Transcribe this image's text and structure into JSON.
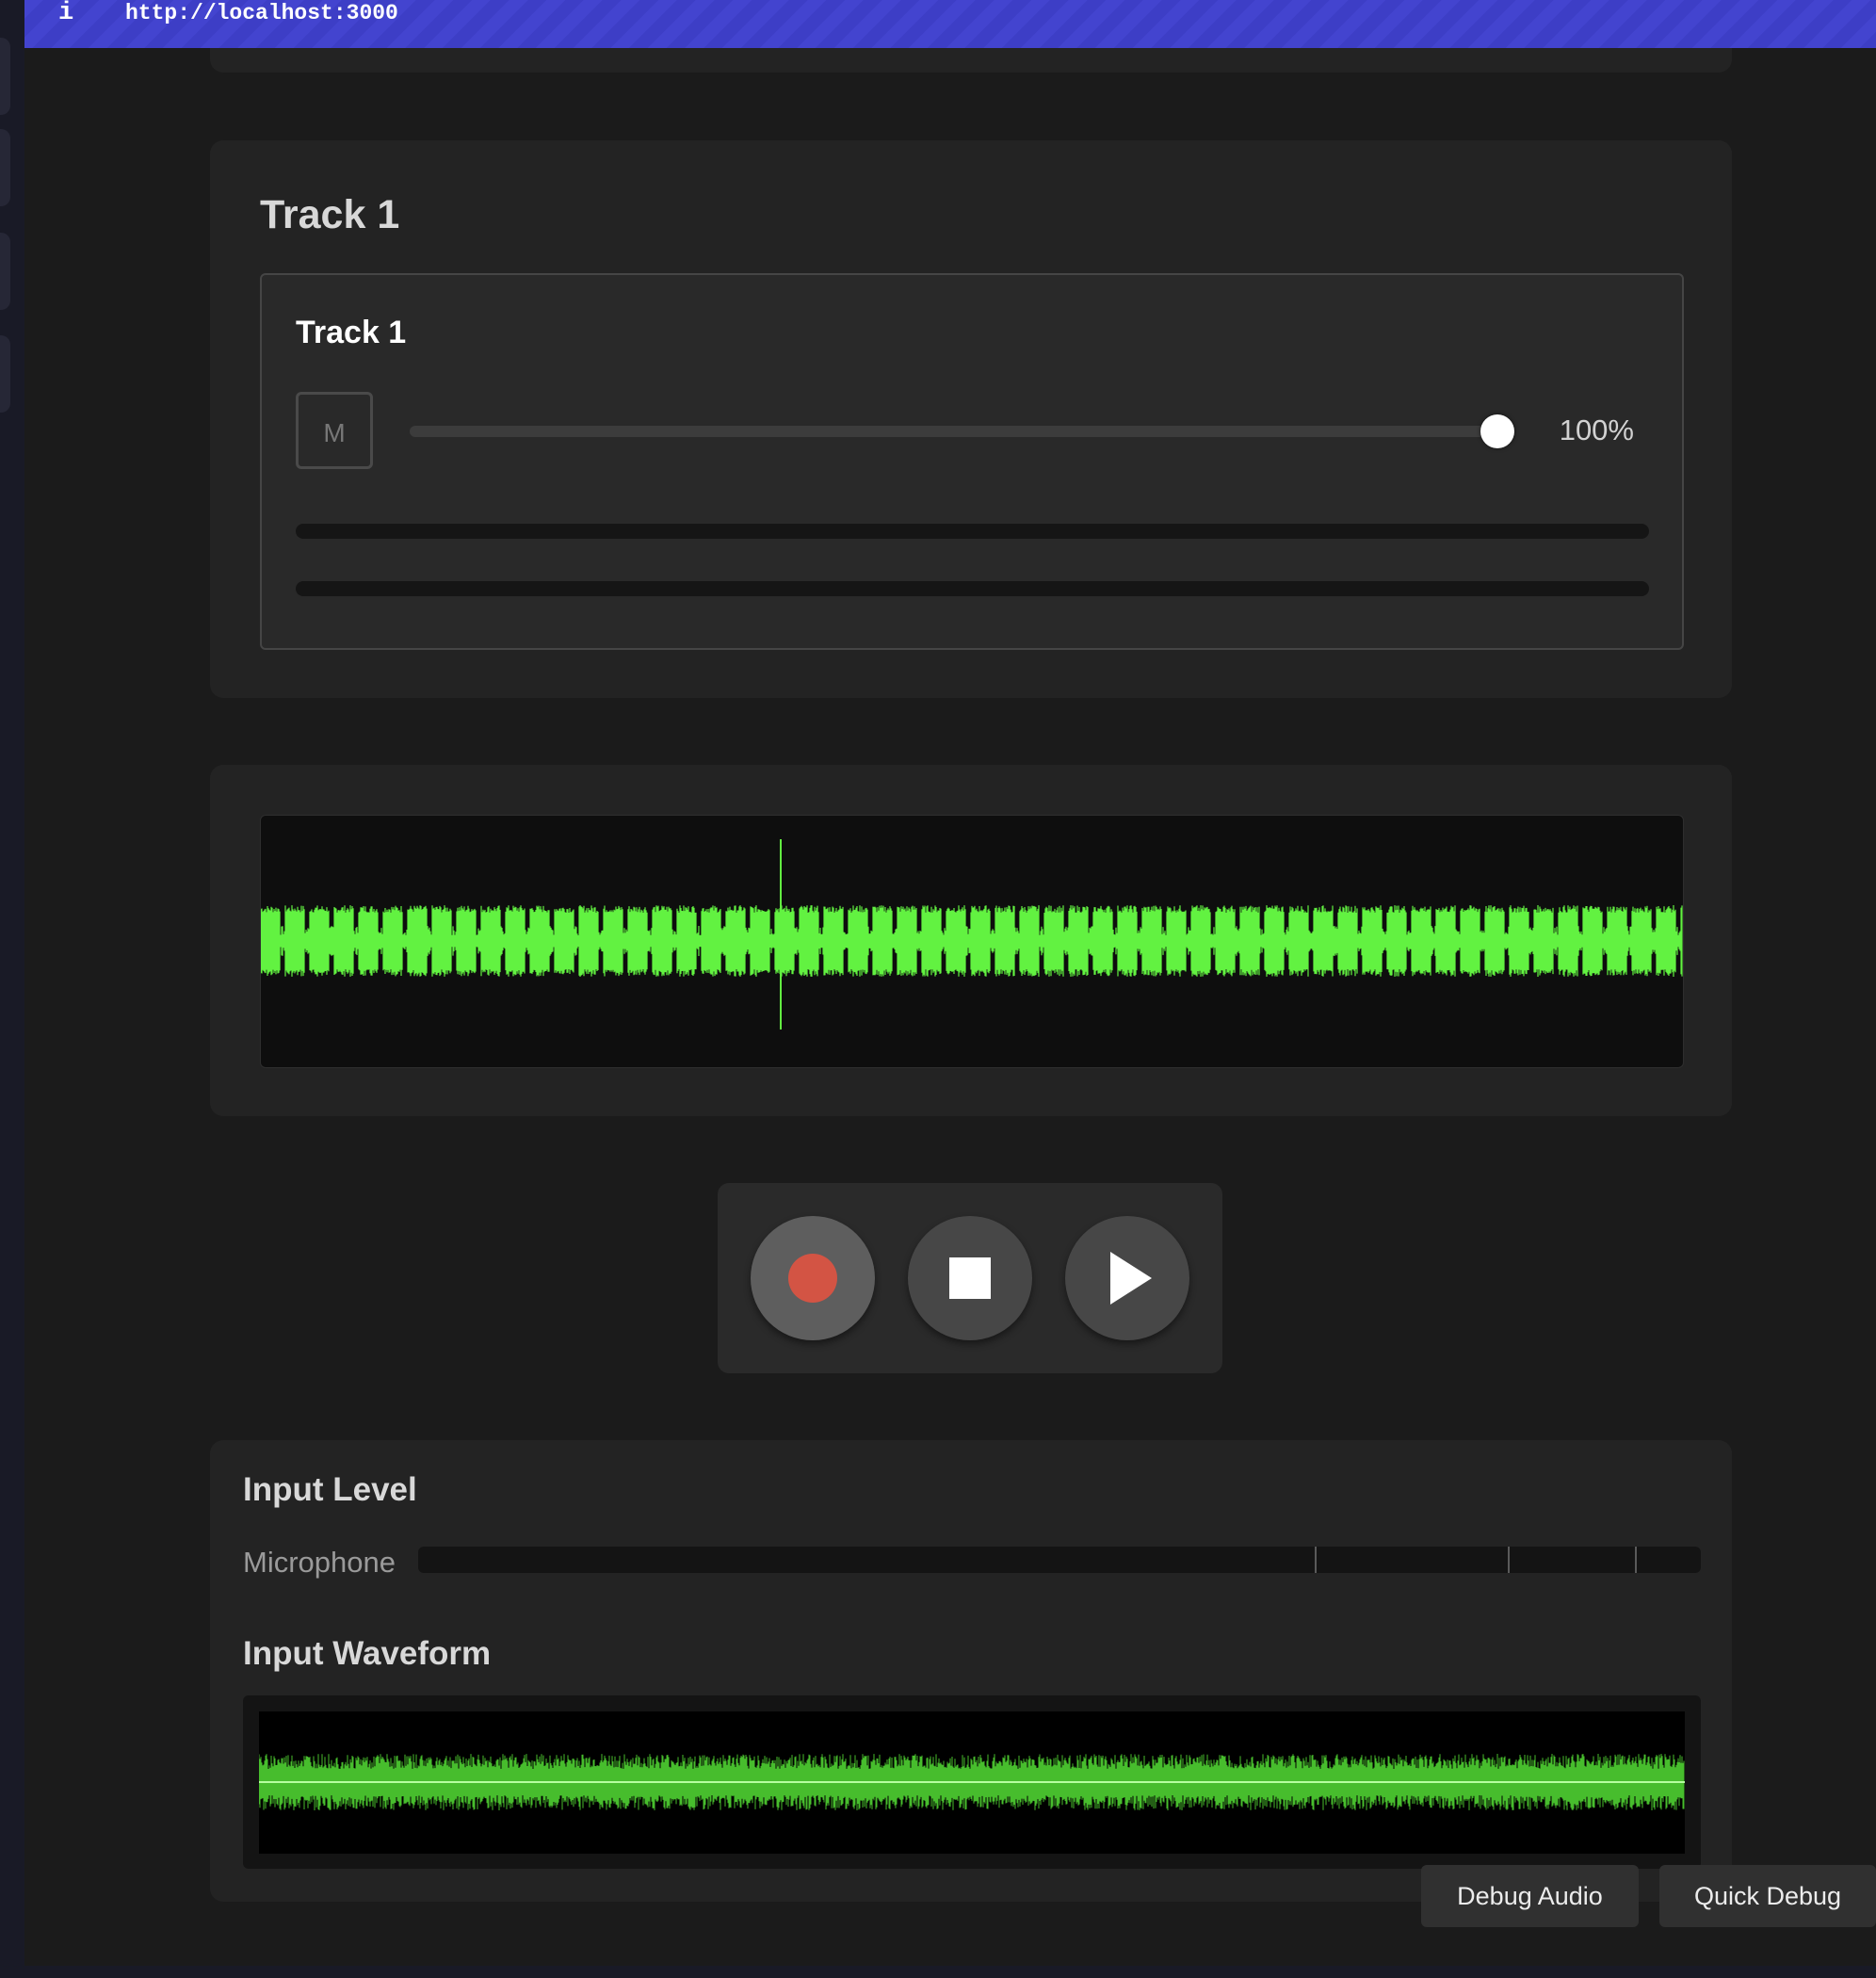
{
  "browser": {
    "info_icon": "i",
    "url": "http://localhost:3000"
  },
  "track_panel": {
    "title": "Track 1",
    "track": {
      "name": "Track 1",
      "mute_label": "M",
      "volume_fraction": 1.0,
      "volume_display": "100%"
    }
  },
  "transport": {
    "record": "record-icon",
    "stop": "stop-icon",
    "play": "play-icon",
    "colors": {
      "record": "#d35444"
    }
  },
  "input": {
    "level_title": "Input Level",
    "mic_label": "Microphone",
    "waveform_title": "Input Waveform"
  },
  "colors": {
    "waveform": "#62f241",
    "input_waveform": "#4fd232"
  },
  "debug": {
    "audio_label": "Debug Audio",
    "quick_label": "Quick Debug"
  }
}
